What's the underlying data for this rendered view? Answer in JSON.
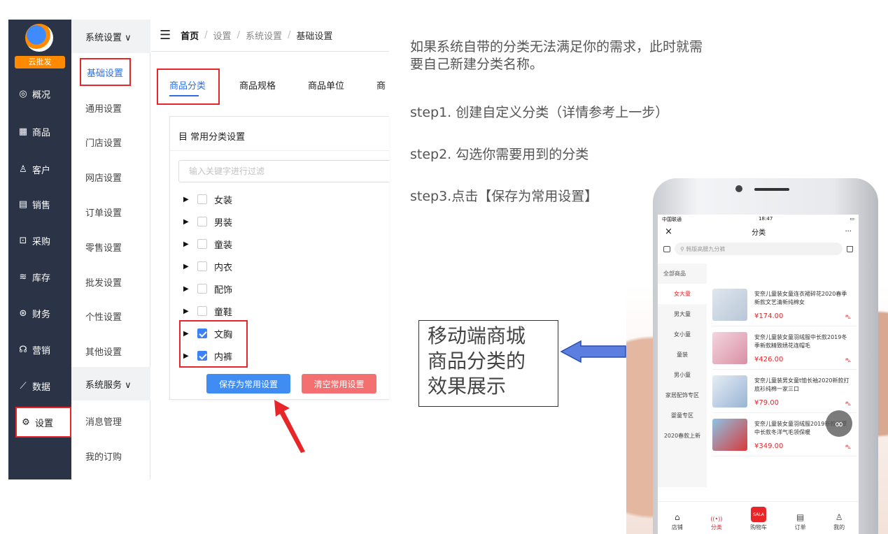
{
  "sidebar": {
    "logo_badge": "云批发",
    "items": [
      {
        "icon": "dashboard-icon",
        "glyph": "◎",
        "label": "概况"
      },
      {
        "icon": "grid-icon",
        "glyph": "▦",
        "label": "商品"
      },
      {
        "icon": "user-icon",
        "glyph": "♙",
        "label": "客户"
      },
      {
        "icon": "receipt-icon",
        "glyph": "▤",
        "label": "销售"
      },
      {
        "icon": "cart-icon",
        "glyph": "⊡",
        "label": "采购"
      },
      {
        "icon": "stack-icon",
        "glyph": "≋",
        "label": "库存"
      },
      {
        "icon": "money-icon",
        "glyph": "⊛",
        "label": "财务"
      },
      {
        "icon": "megaphone-icon",
        "glyph": "☊",
        "label": "营销"
      },
      {
        "icon": "chart-icon",
        "glyph": "⟋",
        "label": "数据"
      },
      {
        "icon": "gear-icon",
        "glyph": "⚙",
        "label": "设置"
      }
    ]
  },
  "submenu": {
    "group1": "系统设置 ∨",
    "items": [
      "基础设置",
      "通用设置",
      "门店设置",
      "网店设置",
      "订单设置",
      "零售设置",
      "批发设置",
      "个性设置",
      "其他设置"
    ],
    "group2": "系统服务 ∨",
    "items2": [
      "消息管理",
      "我的订购"
    ]
  },
  "breadcrumb": {
    "home": "首页",
    "sep": "/",
    "level1": "设置",
    "level2": "系统设置",
    "current": "基础设置"
  },
  "tabs": [
    "商品分类",
    "商品规格",
    "商品单位",
    "商"
  ],
  "card": {
    "title": "目 常用分类设置",
    "filter_placeholder": "输入关键字进行过滤",
    "categories": [
      {
        "label": "女装",
        "checked": false
      },
      {
        "label": "男装",
        "checked": false
      },
      {
        "label": "童装",
        "checked": false
      },
      {
        "label": "内衣",
        "checked": false
      },
      {
        "label": "配饰",
        "checked": false
      },
      {
        "label": "童鞋",
        "checked": false
      },
      {
        "label": "文胸",
        "checked": true
      },
      {
        "label": "内裤",
        "checked": true
      }
    ],
    "save_label": "保存为常用设置",
    "clear_label": "清空常用设置"
  },
  "instructions": {
    "intro_line1": "如果系统自带的分类无法满足你的需求，此时就需",
    "intro_line2": "要自己新建分类名称。",
    "step1": "step1. 创建自定义分类（详情参考上一步）",
    "step2": "step2. 勾选你需要用到的分类",
    "step3": "step3.点击【保存为常用设置】"
  },
  "caption": {
    "line1": "移动端商城",
    "line2": "商品分类的",
    "line3": "效果展示"
  },
  "phone": {
    "carrier": "中国联通",
    "time": "18:47",
    "page_title": "分类",
    "more": "···",
    "close": "×",
    "search_placeholder": "韩版高腰九分裤",
    "all_label": "全部商品",
    "categories": [
      "女大童",
      "男大童",
      "女小童",
      "童装",
      "男小童",
      "家居配饰专区",
      "婴童专区",
      "2020春款上新"
    ],
    "products": [
      {
        "title": "安奈儿童装女童连衣裙碎花2020春季新款文艺清新纯棉女",
        "price": "¥174.00"
      },
      {
        "title": "安奈儿童装女童羽绒服中长款2019冬季新款精致绣花连帽毛",
        "price": "¥426.00"
      },
      {
        "title": "安奈儿童装男女童t恤长袖2020新款打底衫纯棉一家三口",
        "price": "¥79.00"
      },
      {
        "title": "安奈儿童装女童羽绒服2019新款加厚中长款冬洋气毛领保暖",
        "price": "¥349.00"
      }
    ],
    "tabbar": [
      {
        "label": "店铺",
        "icon": "home-icon",
        "glyph": "⌂"
      },
      {
        "label": "分类",
        "icon": "radio-icon",
        "glyph": "((•))"
      },
      {
        "label": "购物车",
        "icon": "cart-icon",
        "glyph": "SALA"
      },
      {
        "label": "订单",
        "icon": "order-icon",
        "glyph": "▤"
      },
      {
        "label": "我的",
        "icon": "user-icon",
        "glyph": "♙"
      }
    ],
    "back": "<",
    "forward": ">"
  },
  "colors": {
    "sidebar_bg": "#2b3447",
    "accent_blue": "#2e6fe0",
    "highlight_red": "#e8262a",
    "logo_orange": "#ff8a00"
  }
}
